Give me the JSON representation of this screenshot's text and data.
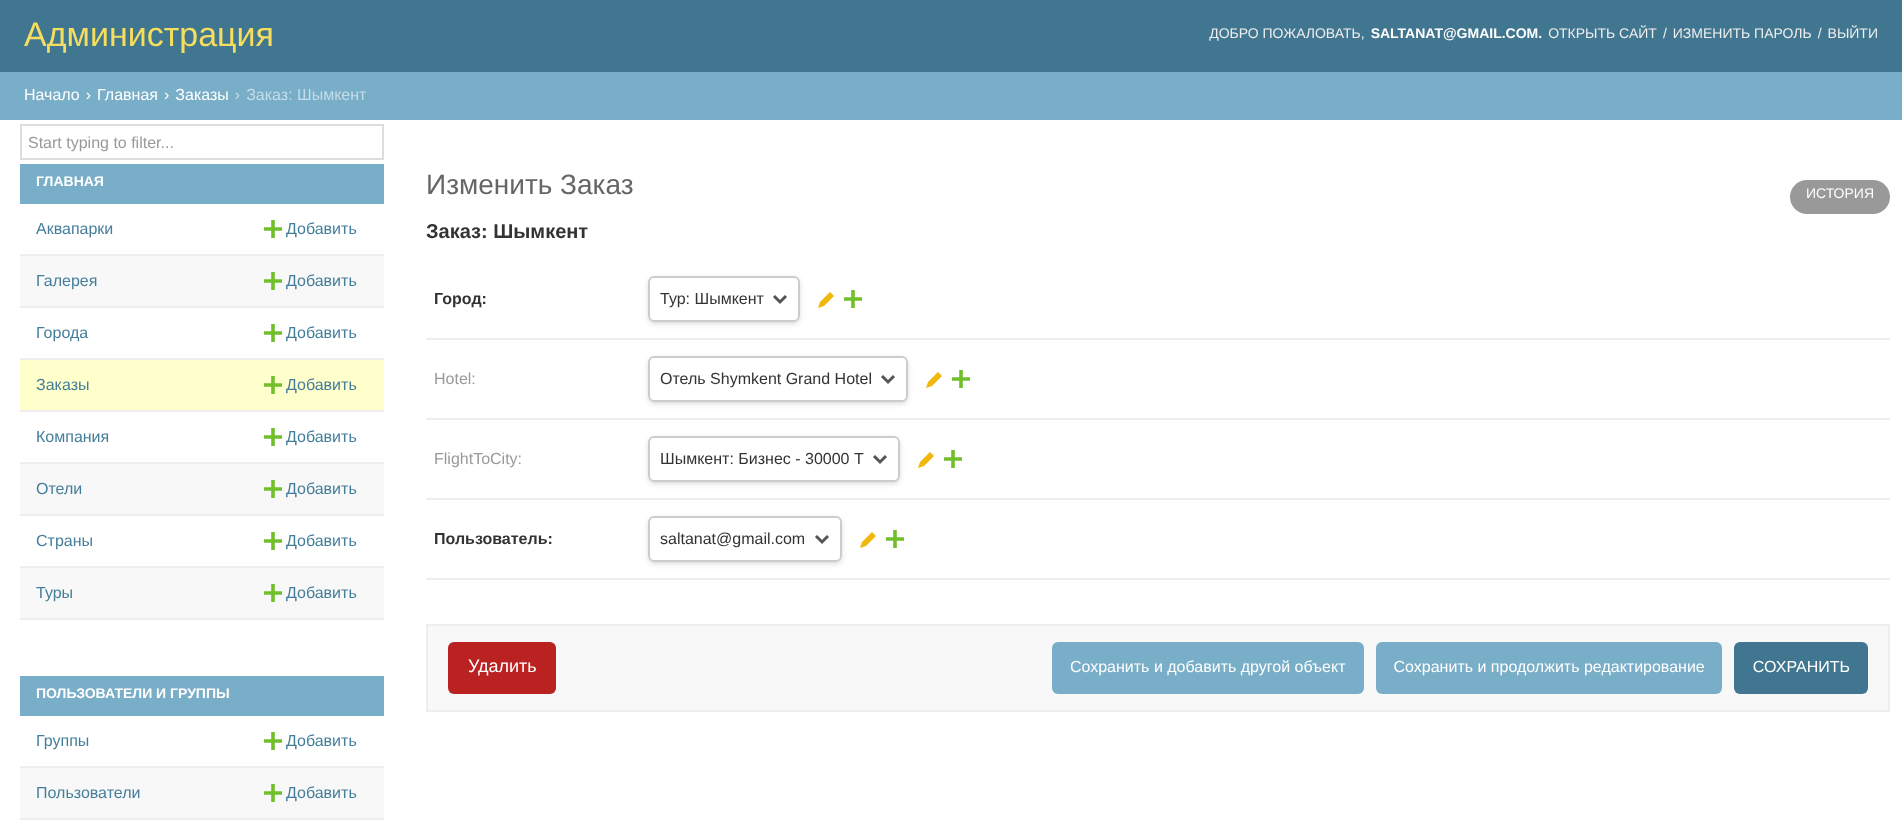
{
  "header": {
    "brand": "Администрация",
    "user_tools": [
      {
        "text": "ДОБРО ПОЖАЛОВАТЬ,",
        "bold": false
      },
      {
        "text": "SALTANAT@GMAIL.COM.",
        "bold": true
      },
      {
        "text": "ОТКРЫТЬ САЙТ",
        "bold": false
      },
      {
        "text": "/",
        "bold": false
      },
      {
        "text": "ИЗМЕНИТЬ ПАРОЛЬ",
        "bold": false
      },
      {
        "text": "/",
        "bold": false
      },
      {
        "text": "ВЫЙТИ",
        "bold": false
      }
    ]
  },
  "breadcrumbs": [
    {
      "text": "Начало",
      "current": false
    },
    {
      "text": "›",
      "current": false
    },
    {
      "text": "Главная",
      "current": false
    },
    {
      "text": "›",
      "current": false
    },
    {
      "text": "Заказы",
      "current": false
    },
    {
      "text": "›",
      "current": true
    },
    {
      "text": "Заказ: Шымкент",
      "current": true
    }
  ],
  "sidebar": {
    "filter_placeholder": "Start typing to filter...",
    "sections": [
      {
        "title": "ГЛАВНАЯ",
        "items": [
          {
            "label": "Аквапарки",
            "add": "Добавить",
            "selected": false
          },
          {
            "label": "Галерея",
            "add": "Добавить",
            "selected": false
          },
          {
            "label": "Города",
            "add": "Добавить",
            "selected": false
          },
          {
            "label": "Заказы",
            "add": "Добавить",
            "selected": true
          },
          {
            "label": "Компания",
            "add": "Добавить",
            "selected": false
          },
          {
            "label": "Отели",
            "add": "Добавить",
            "selected": false
          },
          {
            "label": "Страны",
            "add": "Добавить",
            "selected": false
          },
          {
            "label": "Туры",
            "add": "Добавить",
            "selected": false
          }
        ]
      },
      {
        "title": "ПОЛЬЗОВАТЕЛИ И ГРУППЫ",
        "items": [
          {
            "label": "Группы",
            "add": "Добавить",
            "selected": false
          },
          {
            "label": "Пользователи",
            "add": "Добавить",
            "selected": false
          }
        ]
      }
    ]
  },
  "content": {
    "title": "Изменить Заказ",
    "history_button": "ИСТОРИЯ",
    "object_title": "Заказ: Шымкент",
    "fields": [
      {
        "label": "Город:",
        "value": "Тур: Шымкент",
        "required": true
      },
      {
        "label": "Hotel:",
        "value": "Отель Shymkent Grand Hotel",
        "required": false
      },
      {
        "label": "FlightToCity:",
        "value": "Шымкент: Бизнес - 30000 Т",
        "required": false
      },
      {
        "label": "Пользователь:",
        "value": "saltanat@gmail.com",
        "required": true
      }
    ],
    "delete_button": "Удалить",
    "buttons": [
      {
        "label": "Сохранить и добавить другой объект",
        "kind": "secondary"
      },
      {
        "label": "Сохранить и продолжить редактирование",
        "kind": "secondary"
      },
      {
        "label": "СОХРАНИТЬ",
        "kind": "primary"
      }
    ]
  }
}
